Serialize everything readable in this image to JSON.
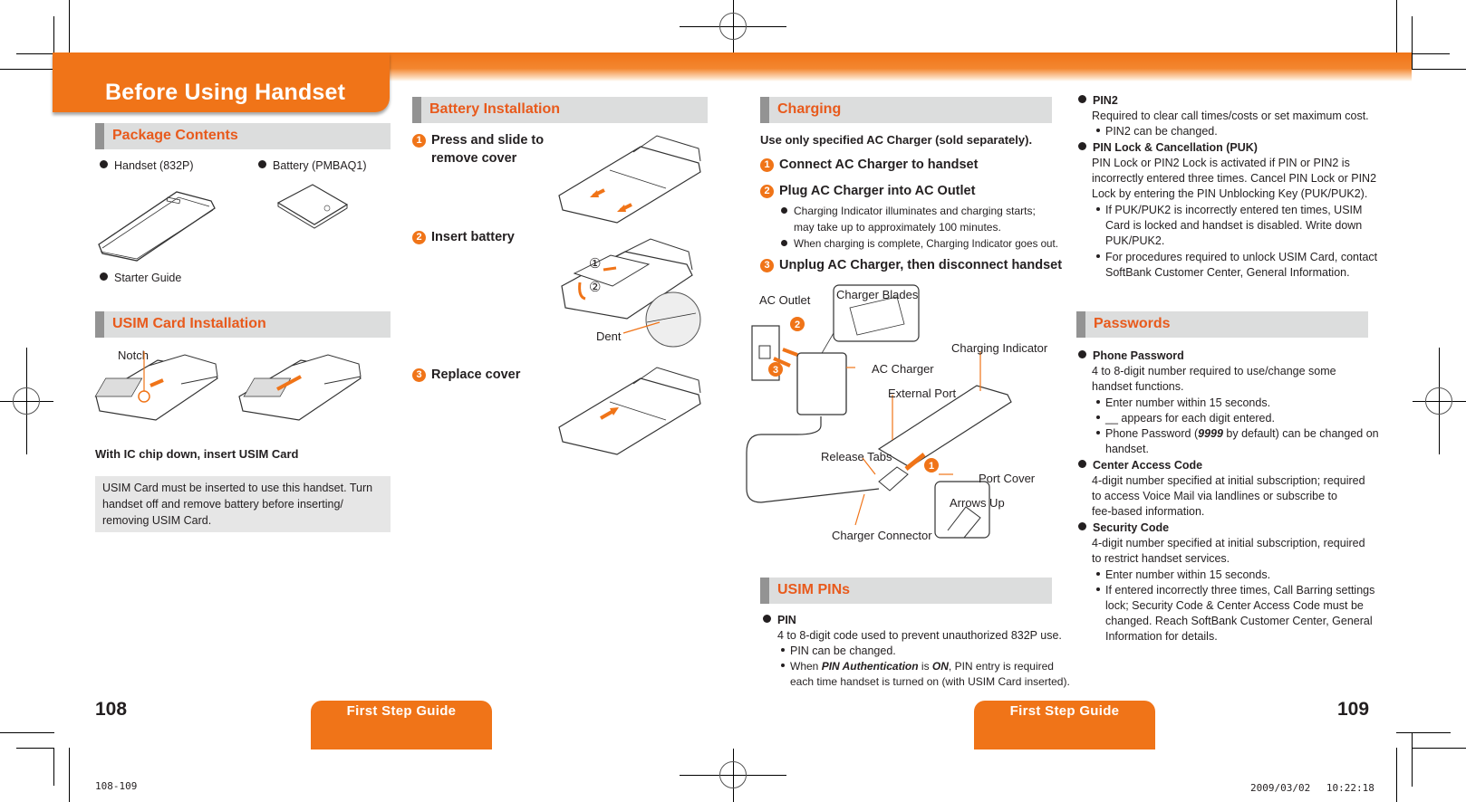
{
  "header": {
    "title": "Before Using Handset"
  },
  "package_contents": {
    "heading": "Package Contents",
    "items": [
      "Handset (832P)",
      "Battery (PMBAQ1)",
      "Starter Guide"
    ]
  },
  "usim_install": {
    "heading": "USIM Card Installation",
    "notch_label": "Notch",
    "instruction": "With IC chip down, insert USIM Card",
    "note": "USIM Card must be inserted to use this handset. Turn handset off and remove battery before inserting/ removing USIM Card."
  },
  "battery_install": {
    "heading": "Battery Installation",
    "steps": [
      {
        "num": "1",
        "line1": "Press and slide to",
        "line2": "remove cover"
      },
      {
        "num": "2",
        "line1": "Insert battery"
      },
      {
        "num": "3",
        "line1": "Replace cover"
      }
    ],
    "dent_label": "Dent",
    "insert_marks": [
      "①",
      "②"
    ]
  },
  "charging": {
    "heading": "Charging",
    "intro": "Use only specified AC Charger (sold separately).",
    "steps": [
      {
        "num": "1",
        "text": "Connect AC Charger to handset"
      },
      {
        "num": "2",
        "text": "Plug AC Charger into AC Outlet",
        "bullets": [
          "Charging Indicator illuminates and charging starts;",
          "may take up to approximately 100 minutes.",
          "When charging is complete, Charging Indicator goes out."
        ]
      },
      {
        "num": "3",
        "text": "Unplug AC Charger, then disconnect handset"
      }
    ],
    "diagram_labels": {
      "ac_outlet": "AC Outlet",
      "charger_blades": "Charger Blades",
      "charging_indicator": "Charging Indicator",
      "ac_charger": "AC Charger",
      "external_port": "External Port",
      "release_tabs": "Release Tabs",
      "port_cover": "Port Cover",
      "arrows_up": "Arrows Up",
      "charger_connector": "Charger Connector",
      "marker_1": "1",
      "marker_2": "2",
      "marker_3": "3"
    }
  },
  "usim_pins": {
    "heading": "USIM PINs",
    "pin": {
      "title": "PIN",
      "desc": "4 to 8-digit code used to prevent unauthorized 832P use.",
      "bullet1": "PIN can be changed.",
      "bullet2_pre": "When ",
      "bullet2_em1": "PIN Authentication",
      "bullet2_mid": " is ",
      "bullet2_em2": "ON",
      "bullet2_post": ", PIN entry is required",
      "bullet2_line2": "each time handset is turned on (with USIM Card inserted)."
    },
    "pin2": {
      "title": "PIN2",
      "desc": "Required to clear call times/costs or set maximum cost.",
      "bullet1": "PIN2 can be changed."
    },
    "puk": {
      "title": "PIN Lock & Cancellation (PUK)",
      "lines": [
        "PIN Lock or PIN2 Lock is activated if PIN or PIN2 is",
        "incorrectly entered three times. Cancel PIN Lock or PIN2",
        "Lock by entering the PIN Unblocking Key (PUK/PUK2)."
      ],
      "bullet1": [
        "If PUK/PUK2 is incorrectly entered ten times, USIM",
        "Card is locked and handset is disabled. Write down",
        "PUK/PUK2."
      ],
      "bullet2": [
        "For procedures required to unlock USIM Card, contact",
        "SoftBank Customer Center, General Information."
      ]
    }
  },
  "passwords": {
    "heading": "Passwords",
    "phone_password": {
      "title": "Phone Password",
      "lines": [
        "4 to 8-digit number required to use/change some",
        "handset functions."
      ],
      "bullet1": "Enter number within 15 seconds.",
      "bullet2_glyph": "__",
      "bullet2": " appears for each digit entered.",
      "bullet3_pre": "Phone Password (",
      "bullet3_em": "9999",
      "bullet3_post": " by default) can be changed on",
      "bullet3_line2": "handset."
    },
    "center_access": {
      "title": "Center Access Code",
      "lines": [
        "4-digit number specified at initial subscription; required",
        "to access Voice Mail via landlines or subscribe to",
        "fee-based information."
      ]
    },
    "security_code": {
      "title": "Security Code",
      "lines": [
        "4-digit number specified at initial subscription, required",
        "to restrict handset services."
      ],
      "bullet1": "Enter number within 15 seconds.",
      "bullet2": [
        "If entered incorrectly three times, Call Barring settings",
        "lock; Security Code & Center Access Code must be",
        "changed. Reach SoftBank Customer Center, General",
        "Information for details."
      ]
    }
  },
  "footer": {
    "left_page": "108",
    "right_page": "109",
    "left_tab": "First Step Guide",
    "right_tab": "First Step Guide",
    "file_ref": "108-109",
    "timestamp": "2009/03/02　 10:22:18"
  },
  "colors": {
    "accent": "#f07418",
    "heading_text": "#e85a1c",
    "section_bg": "#dcdddd",
    "section_bar": "#939393",
    "note_bg": "#e6e6e6"
  }
}
